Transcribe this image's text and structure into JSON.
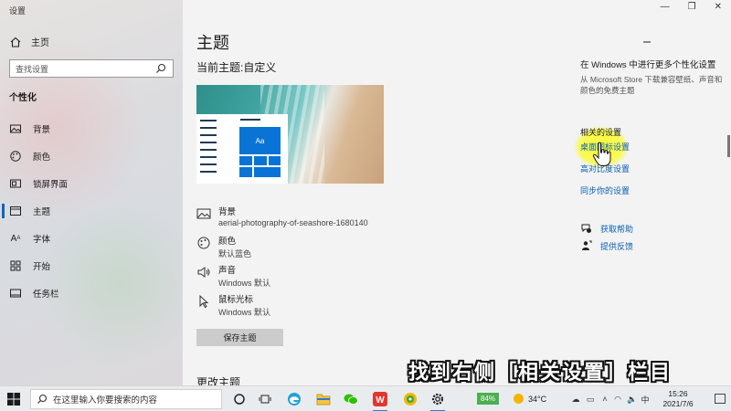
{
  "window": {
    "title": "设置",
    "controls": [
      "—",
      "❐",
      "✕"
    ]
  },
  "sidebar": {
    "home": "主页",
    "search_placeholder": "查找设置",
    "section": "个性化",
    "items": [
      {
        "label": "背景",
        "icon": "picture-icon"
      },
      {
        "label": "颜色",
        "icon": "palette-icon"
      },
      {
        "label": "锁屏界面",
        "icon": "lockscreen-icon"
      },
      {
        "label": "主题",
        "icon": "theme-icon",
        "active": true
      },
      {
        "label": "字体",
        "icon": "font-icon"
      },
      {
        "label": "开始",
        "icon": "start-icon"
      },
      {
        "label": "任务栏",
        "icon": "taskbar-icon"
      }
    ]
  },
  "main": {
    "title": "主题",
    "current_theme": "当前主题:自定义",
    "preview_tile_text": "Aa",
    "properties": [
      {
        "name": "背景",
        "value": "aerial-photography-of-seashore-1680140",
        "icon": "picture-icon"
      },
      {
        "name": "颜色",
        "value": "默认蓝色",
        "icon": "palette-icon"
      },
      {
        "name": "声音",
        "value": "Windows 默认",
        "icon": "speaker-icon"
      },
      {
        "name": "鼠标光标",
        "value": "Windows 默认",
        "icon": "cursor-icon"
      }
    ],
    "save_button": "保存主题",
    "change_theme": "更改主题",
    "subtitle": "找到右侧［相关设置］栏目"
  },
  "right": {
    "heading": "在 Windows 中进行更多个性化设置",
    "description": "从 Microsoft Store 下载兼容壁纸、声音和颜色的免费主题",
    "related_heading": "相关的设置",
    "links": [
      "桌面图标设置",
      "高对比度设置",
      "同步你的设置"
    ],
    "help": [
      {
        "label": "获取帮助",
        "icon": "help-chat-icon"
      },
      {
        "label": "提供反馈",
        "icon": "feedback-icon"
      }
    ]
  },
  "taskbar": {
    "search_placeholder": "在这里输入你要搜索的内容",
    "battery": "84%",
    "temperature": "34°C",
    "ime": "中",
    "time": "15:26",
    "date": "2021/7/6"
  },
  "colors": {
    "accent": "#0a74d6",
    "link": "#0a5fb4",
    "highlight": "#f5f53c"
  }
}
